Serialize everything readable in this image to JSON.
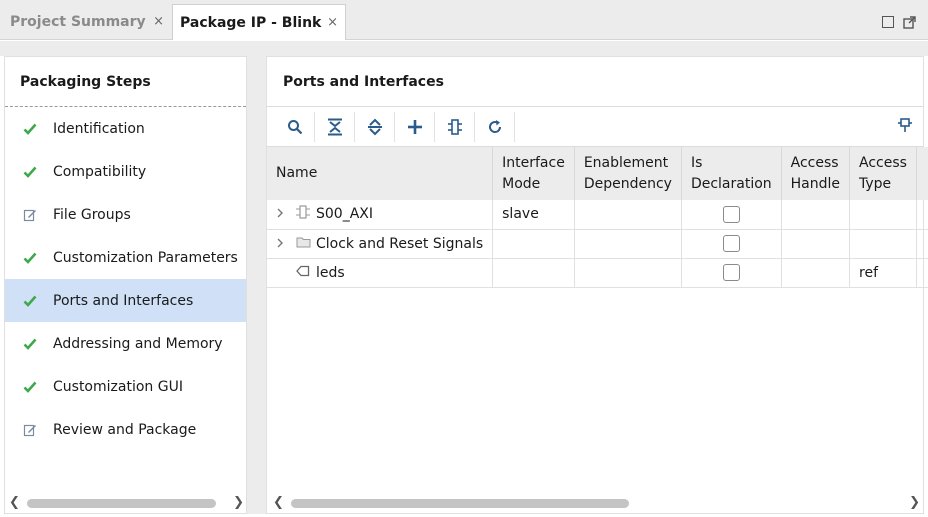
{
  "tabs": [
    {
      "label": "Project Summary",
      "active": false
    },
    {
      "label": "Package IP - Blink",
      "active": true
    }
  ],
  "tab_close_glyph": "×",
  "left": {
    "title": "Packaging Steps",
    "steps": [
      {
        "label": "Identification",
        "status": "check"
      },
      {
        "label": "Compatibility",
        "status": "check"
      },
      {
        "label": "File Groups",
        "status": "edit"
      },
      {
        "label": "Customization Parameters",
        "status": "check"
      },
      {
        "label": "Ports and Interfaces",
        "status": "check",
        "selected": true
      },
      {
        "label": "Addressing and Memory",
        "status": "check"
      },
      {
        "label": "Customization GUI",
        "status": "check"
      },
      {
        "label": "Review and Package",
        "status": "edit"
      }
    ]
  },
  "right": {
    "title": "Ports and Interfaces",
    "toolbar": [
      "search-icon",
      "collapse-all-icon",
      "expand-all-icon",
      "add-icon",
      "auto-infer-icon",
      "refresh-icon"
    ],
    "columns": [
      {
        "label": "Name",
        "width": 220
      },
      {
        "label": "Interface Mode",
        "width": 84
      },
      {
        "label": "Enablement Dependency",
        "width": 105
      },
      {
        "label": "Is Declaration",
        "width": 98
      },
      {
        "label": "Access Handle",
        "width": 70
      },
      {
        "label": "Access Type",
        "width": 70
      }
    ],
    "rows": [
      {
        "name": "S00_AXI",
        "icon": "interface-icon",
        "expandable": true,
        "mode": "slave",
        "dependency": "",
        "declaration": false,
        "handle": "",
        "type": ""
      },
      {
        "name": "Clock and Reset Signals",
        "icon": "folder-icon",
        "expandable": true,
        "mode": "",
        "dependency": "",
        "declaration": false,
        "handle": "",
        "type": ""
      },
      {
        "name": "leds",
        "icon": "port-icon",
        "expandable": false,
        "mode": "",
        "dependency": "",
        "declaration": false,
        "handle": "",
        "type": "ref"
      }
    ]
  },
  "colors": {
    "check": "#3ea84a",
    "selected": "#cfe0f7",
    "header": "#ececec"
  }
}
